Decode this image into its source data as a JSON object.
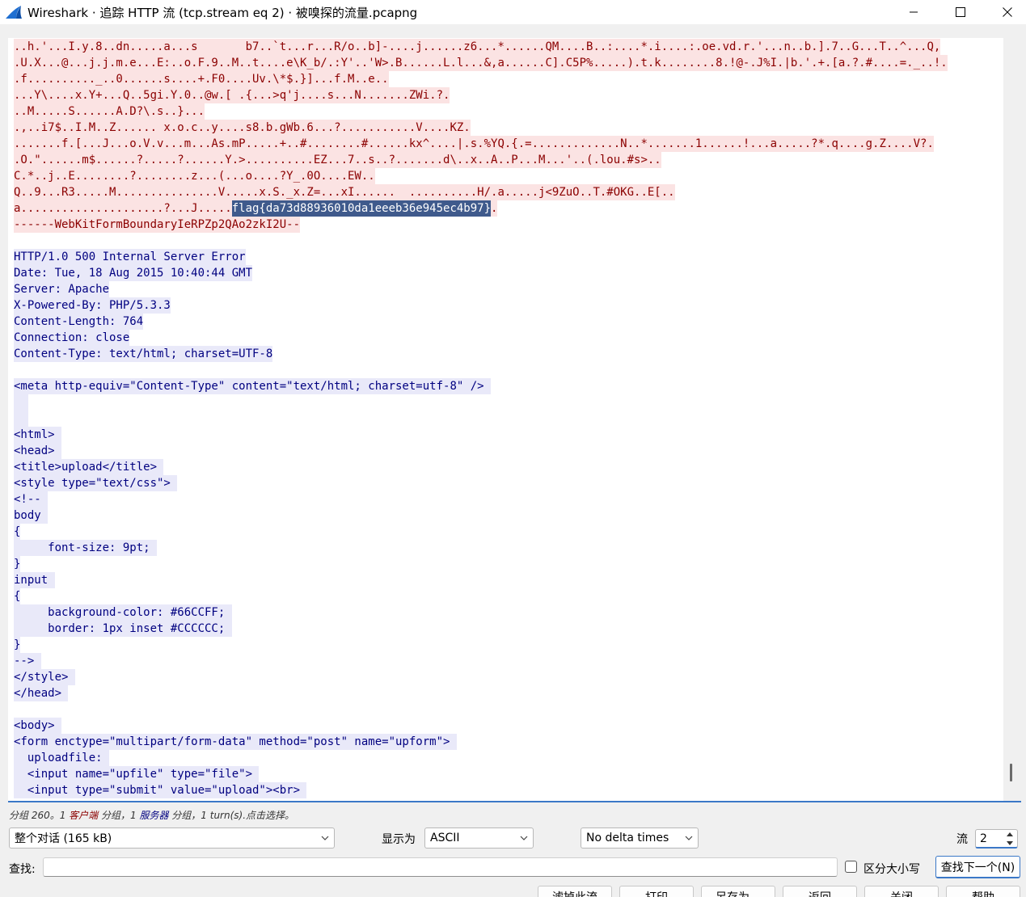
{
  "window": {
    "title": "Wireshark · 追踪 HTTP 流 (tcp.stream eq 2) · 被嗅探的流量.pcapng"
  },
  "colors": {
    "client_text": "#8b0000",
    "client_bg": "#fbe3e3",
    "server_text": "#000080",
    "server_bg": "#e9e9f9",
    "selection_bg": "#3f5a8c",
    "accent": "#3b78c7"
  },
  "stream": {
    "client_lines": [
      "..h.'...I.y.8..dn.....a...s       b7..`t...r...R/o..b]-....j......z6...*......QM....B..:....*.i....:.oe.vd.r.'...n..b.].7..G...T..^...Q,",
      ".U.X...@...j.j.m.e...E:..o.F.9..M..t....e\\K_b/.:Y'..'W>.B......L.l...&,a......C].C5P%.....).t.k........8.!@-.J%I.|b.'.+.[a.?.#....=._..!.",
      ".f.........._..0......s....+.F0....Uv.\\*$.}]...f.M..e..",
      "...Y\\....x.Y+...Q..5gi.Y.0..@w.[ .{...>q'j....s...N.......ZWi.?.",
      "..M.....S......A.D?\\.s..}...",
      ".,..i7$..I.M..Z...... x.o.c..y....s8.b.gWb.6...?...........V....KZ.",
      ".......f.[...J...o.V.v...m...As.mP.....+..#........#......kx^....|.s.%YQ.{.=.............N..*.......1......!...a.....?*.q....g.Z....V?.",
      ".O.\"......m$......?.....?......Y.>..........EZ...7..s..?.......d\\..x..A..P...M...'..(.lou.#s>..",
      "C.*..j..E........?........z...(...o....?Y_.0O....EW..",
      "Q..9...R3.....M...............V.....x.S._x.Z=...xI......  ..........H/.a.....j<9ZuO..T.#OKG..E[.."
    ],
    "flag_line_prefix": "a.....................?...J.....",
    "flag_text": "flag{da73d88936010da1eeeb36e945ec4b97}",
    "flag_line_suffix": ".",
    "boundary_line": "------WebKitFormBoundaryIeRPZp2QAo2zkI2U--",
    "server_header_lines": [
      "HTTP/1.0 500 Internal Server Error",
      "Date: Tue, 18 Aug 2015 10:40:44 GMT",
      "Server: Apache",
      "X-Powered-By: PHP/5.3.3",
      "Content-Length: 764",
      "Connection: close",
      "Content-Type: text/html; charset=UTF-8"
    ],
    "meta_line": "<meta http-equiv=\"Content-Type\" content=\"text/html; charset=utf-8\" /> ",
    "html_lines": [
      "<html> ",
      "<head> ",
      "<title>upload</title> ",
      "<style type=\"text/css\"> ",
      "<!-- ",
      "body ",
      "{",
      "     font-size: 9pt; ",
      "}",
      "input ",
      "{",
      "     background-color: #66CCFF; ",
      "     border: 1px inset #CCCCCC; ",
      "}",
      "--> ",
      "</style> ",
      "</head> "
    ],
    "body_lines": [
      "<body> ",
      "<form enctype=\"multipart/form-data\" method=\"post\" name=\"upform\"> ",
      "  uploadfile: ",
      "  <input name=\"upfile\" type=\"file\"> ",
      "  <input type=\"submit\" value=\"upload\"><br> "
    ]
  },
  "status": {
    "prefix": "分组 260。1 ",
    "client": "客户端",
    "mid1": " 分组，1 ",
    "server": "服务器",
    "suffix": " 分组，1 turn(s).点击选择。"
  },
  "controls": {
    "conversation_select": "整个对话 (165 kB)",
    "show_as_label": "显示为",
    "show_as_value": "ASCII",
    "delta_select": "No delta times",
    "stream_label": "流",
    "stream_value": "2",
    "find_label": "查找:",
    "find_value": "",
    "case_label": "区分大小写",
    "find_next_button": "查找下一个(N)"
  },
  "bottom_buttons": [
    "滤掉此流",
    "打印",
    "另存为…",
    "返回",
    "关闭",
    "帮助"
  ]
}
